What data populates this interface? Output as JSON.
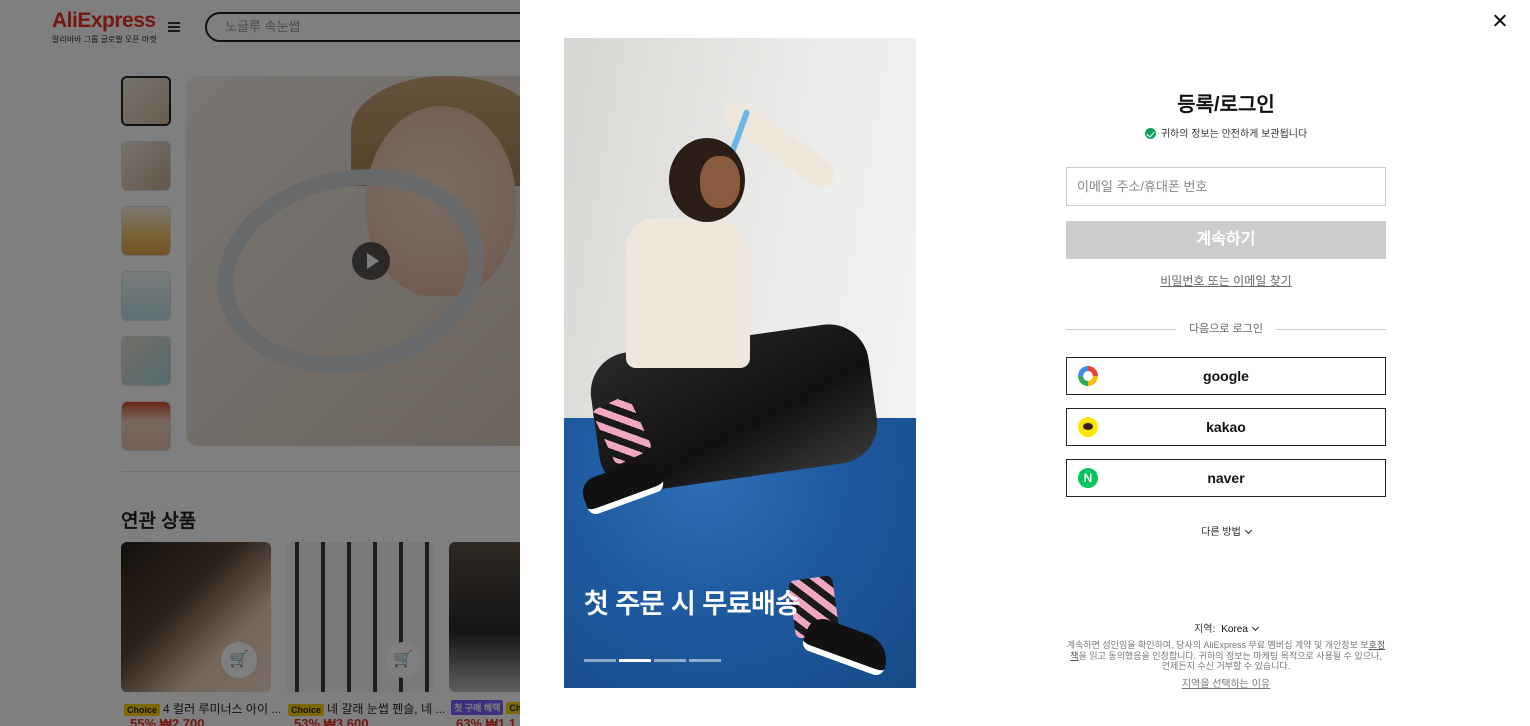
{
  "background": {
    "logo": {
      "main": "AliExpress",
      "sub": "알리바바 그룹 글로벌 오픈 마켓"
    },
    "search": {
      "placeholder": "노글루 속눈썹"
    },
    "related_title": "연관 상품",
    "products": [
      {
        "badge": "Choice",
        "title": "4 컬러 루미너스 아이 ...",
        "price": "55% ₩2,700"
      },
      {
        "badge": "Choice",
        "title": "네 갈래 눈썹 펜슬, 네 ...",
        "price": "53% ₩3,600"
      },
      {
        "badge": "첫 구매 혜택",
        "title": "Choi",
        "price": "63% ₩1,1"
      }
    ]
  },
  "modal": {
    "promo_text": "첫 주문 시 무료배송",
    "slides": {
      "count": 4,
      "active_index": 1
    },
    "title": "등록/로그인",
    "secure_note": "귀하의 정보는 안전하게 보관됩니다",
    "email_placeholder": "이메일 주소/휴대폰 번호",
    "continue_label": "계속하기",
    "forgot_label": "비밀번호 또는 이메일 찾기",
    "or_label": "다음으로 로그인",
    "social": [
      {
        "label": "google",
        "icon": "google-icon"
      },
      {
        "label": "kakao",
        "icon": "kakao-icon"
      },
      {
        "label": "naver",
        "icon": "naver-icon"
      }
    ],
    "more_label": "다른 방법",
    "region_label": "지역:",
    "region_value": "Korea",
    "terms_pre": "계속하면 성인임을 확인하며, 당사의 AliExpress 무료 멤버십 계약 및 개인정보 보",
    "terms_link": "호정책",
    "terms_post": "을 읽고 동의했음을 인정합니다. 귀하의 정보는 마케팅 목적으로 사용될 수 있으나, 언제든지 수신 거부할 수 있습니다.",
    "why_region": "지역을 선택하는 이유"
  },
  "colors": {
    "brand": "#e43225",
    "overlay": "rgba(0,0,0,0.5)",
    "continue_disabled": "#cccccc",
    "secure": "#0aa45c"
  }
}
